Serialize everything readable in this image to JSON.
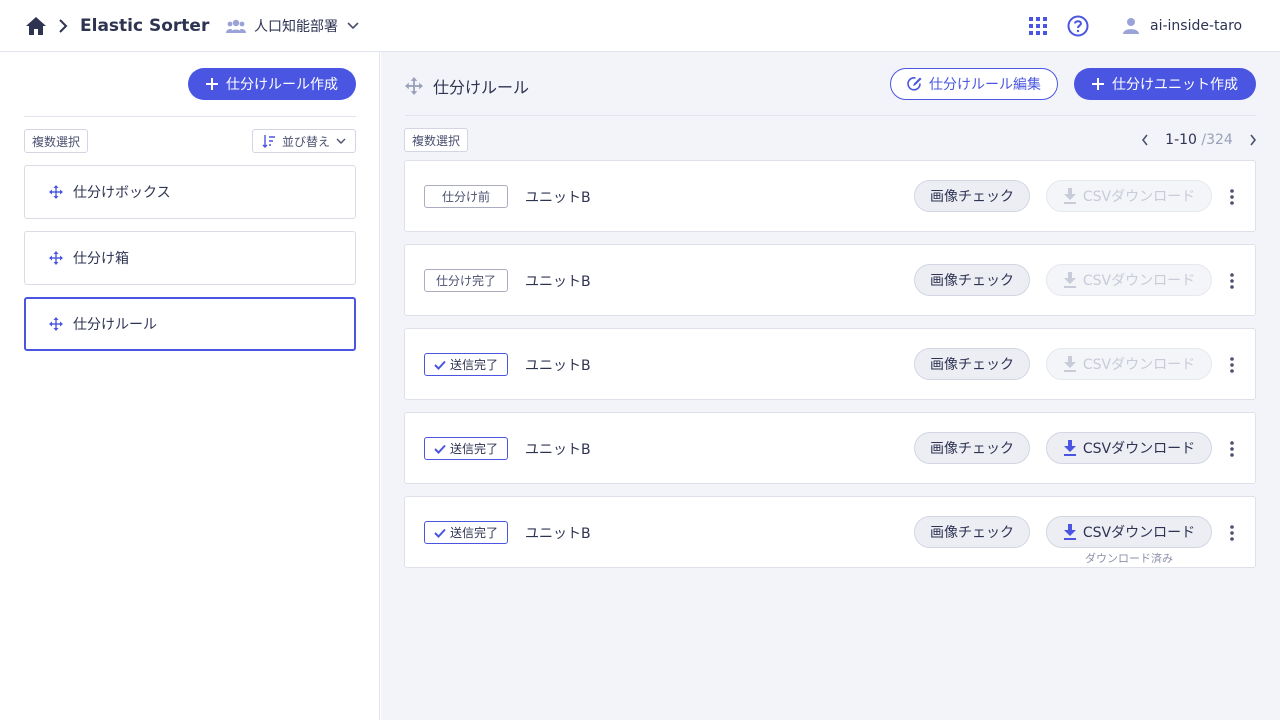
{
  "header": {
    "app_title": "Elastic Sorter",
    "department": "人口知能部署",
    "user_name": "ai-inside-taro"
  },
  "left": {
    "create_rule_label": "仕分けルール作成",
    "multi_select_label": "複数選択",
    "sort_label": "並び替え",
    "items": [
      {
        "label": "仕分けボックス",
        "selected": false
      },
      {
        "label": "仕分け箱",
        "selected": false
      },
      {
        "label": "仕分けルール",
        "selected": true
      }
    ]
  },
  "right": {
    "title": "仕分けルール",
    "edit_rule_label": "仕分けルール編集",
    "create_unit_label": "仕分けユニット作成",
    "multi_select_label": "複数選択",
    "pager": {
      "range": "1-10",
      "total": "/324"
    },
    "rows": [
      {
        "status": "仕分け前",
        "name": "ユニットB",
        "image_check": "画像チェック",
        "csv_label": "CSVダウンロード",
        "csv_enabled": false,
        "note": ""
      },
      {
        "status": "仕分け完了",
        "name": "ユニットB",
        "image_check": "画像チェック",
        "csv_label": "CSVダウンロード",
        "csv_enabled": false,
        "note": ""
      },
      {
        "status": "送信完了",
        "name": "ユニットB",
        "image_check": "画像チェック",
        "csv_label": "CSVダウンロード",
        "csv_enabled": false,
        "note": ""
      },
      {
        "status": "送信完了",
        "name": "ユニットB",
        "image_check": "画像チェック",
        "csv_label": "CSVダウンロード",
        "csv_enabled": true,
        "note": ""
      },
      {
        "status": "送信完了",
        "name": "ユニットB",
        "image_check": "画像チェック",
        "csv_label": "CSVダウンロード",
        "csv_enabled": true,
        "note": "ダウンロード済み"
      }
    ]
  },
  "colors": {
    "accent": "#4a56e2",
    "text": "#2e3352",
    "panel_bg": "#f3f4f9"
  }
}
